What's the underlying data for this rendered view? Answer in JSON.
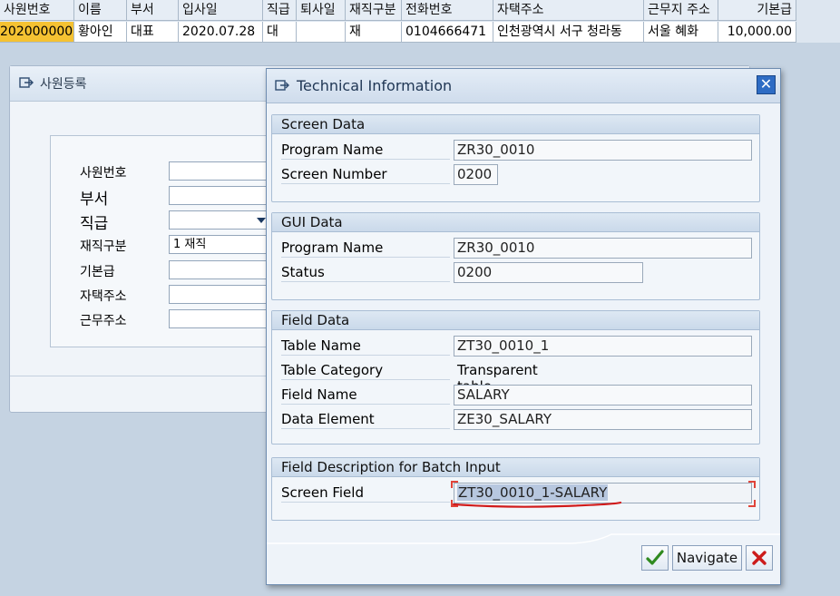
{
  "grid": {
    "headers": [
      "사원번호",
      "이름",
      "부서",
      "입사일",
      "직급",
      "퇴사일",
      "재직구분",
      "전화번호",
      "자택주소",
      "근무지 주소",
      "기본급"
    ],
    "row": [
      "202000000",
      "황아인",
      "대표",
      "2020.07.28",
      "대",
      "",
      "재",
      "0104666471",
      "인천광역시 서구 청라동",
      "서울 혜화",
      "10,000.00"
    ]
  },
  "bg_window": {
    "title": "사원등록",
    "fields": [
      {
        "label": "사원번호",
        "value": ""
      },
      {
        "label": "부서",
        "value": ""
      },
      {
        "label": "직급",
        "value": ""
      },
      {
        "label": "재직구분",
        "value": "1 재직"
      },
      {
        "label": "기본급",
        "value": ""
      },
      {
        "label": "자택주소",
        "value": ""
      },
      {
        "label": "근무주소",
        "value": ""
      }
    ]
  },
  "dialog": {
    "title": "Technical Information",
    "close_icon": "close-icon",
    "groups": {
      "screen": {
        "header": "Screen Data",
        "program_name_label": "Program Name",
        "program_name": "ZR30_0010",
        "screen_number_label": "Screen Number",
        "screen_number": "0200"
      },
      "gui": {
        "header": "GUI Data",
        "program_name_label": "Program Name",
        "program_name": "ZR30_0010",
        "status_label": "Status",
        "status": "0200"
      },
      "field": {
        "header": "Field Data",
        "table_name_label": "Table Name",
        "table_name": "ZT30_0010_1",
        "table_category_label": "Table Category",
        "table_category": "Transparent table",
        "field_name_label": "Field Name",
        "field_name": "SALARY",
        "data_element_label": "Data Element",
        "data_element": "ZE30_SALARY"
      },
      "batch": {
        "header": "Field Description for Batch Input",
        "screen_field_label": "Screen Field",
        "screen_field": "ZT30_0010_1-SALARY"
      }
    },
    "buttons": {
      "ok_icon": "check-icon",
      "navigate": "Navigate",
      "cancel_icon": "cancel-icon"
    }
  },
  "colors": {
    "selected_row": "#f5c232",
    "close_button": "#2e6cc4",
    "annotation": "#d11a1a"
  }
}
